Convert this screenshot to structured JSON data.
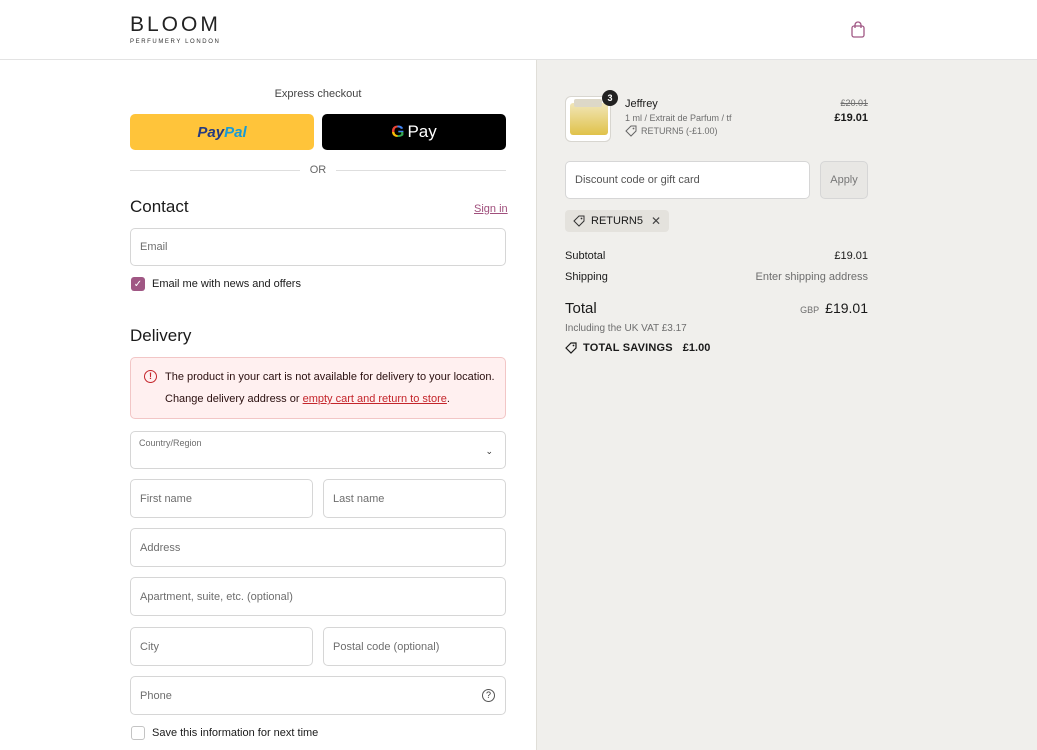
{
  "header": {
    "logo_main": "BLOOM",
    "logo_sub": "PERFUMERY LONDON",
    "cart_icon": "shopping-bag-icon"
  },
  "express": {
    "title": "Express checkout",
    "paypal_label_1": "Pay",
    "paypal_label_2": "Pal",
    "gpay_g": "G",
    "gpay_label": "Pay",
    "or": "OR"
  },
  "contact": {
    "title": "Contact",
    "signin": "Sign in",
    "email_placeholder": "Email",
    "news_label": "Email me with news and offers",
    "news_checked": true
  },
  "delivery": {
    "title": "Delivery",
    "alert_line1": "The product in your cart is not available for delivery to your location.",
    "alert_line2_prefix": "Change delivery address or ",
    "alert_link": "empty cart and return to store",
    "alert_line2_suffix": ".",
    "country_label": "Country/Region",
    "first_name": "First name",
    "last_name": "Last name",
    "address": "Address",
    "apartment": "Apartment, suite, etc. (optional)",
    "city": "City",
    "postal": "Postal code (optional)",
    "phone": "Phone",
    "save_info": "Save this information for next time"
  },
  "summary": {
    "item": {
      "quantity": "3",
      "name": "Jeffrey",
      "variant": "1 ml / Extrait de Parfum / tf",
      "discount": "RETURN5 (-£1.00)",
      "old_price": "£20.01",
      "price": "£19.01"
    },
    "discount_placeholder": "Discount code or gift card",
    "apply": "Apply",
    "applied_code": "RETURN5",
    "subtotal_label": "Subtotal",
    "subtotal_value": "£19.01",
    "shipping_label": "Shipping",
    "shipping_value": "Enter shipping address",
    "total_label": "Total",
    "currency": "GBP",
    "total_value": "£19.01",
    "vat": "Including the UK VAT £3.17",
    "savings_label": "TOTAL SAVINGS",
    "savings_value": "£1.00"
  },
  "colors": {
    "accent": "#a05784",
    "paypal_yellow": "#ffc43a",
    "error": "#c4252b",
    "summary_bg": "#f0efec"
  }
}
